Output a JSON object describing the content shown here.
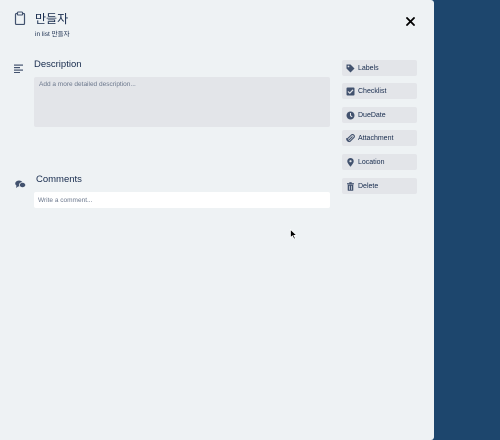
{
  "card": {
    "title": "만들자",
    "subtitle": "in list 만들자",
    "close_label": "×"
  },
  "description": {
    "title": "Description",
    "placeholder": "Add a more detailed description..."
  },
  "comments": {
    "title": "Comments",
    "placeholder": "Write a comment..."
  },
  "sidebar": {
    "buttons": [
      {
        "label": "Labels",
        "icon": "tag-icon"
      },
      {
        "label": "Checklist",
        "icon": "checkbox-icon"
      },
      {
        "label": "DueDate",
        "icon": "clock-icon"
      },
      {
        "label": "Attachment",
        "icon": "paperclip-icon"
      },
      {
        "label": "Location",
        "icon": "map-pin-icon"
      },
      {
        "label": "Delete",
        "icon": "trash-icon"
      }
    ]
  },
  "colors": {
    "modal_bg": "#eef2f4",
    "backdrop": "#1d466d",
    "button_bg": "#e3e5e9",
    "text": "#172b4d",
    "placeholder": "#6b778c"
  }
}
